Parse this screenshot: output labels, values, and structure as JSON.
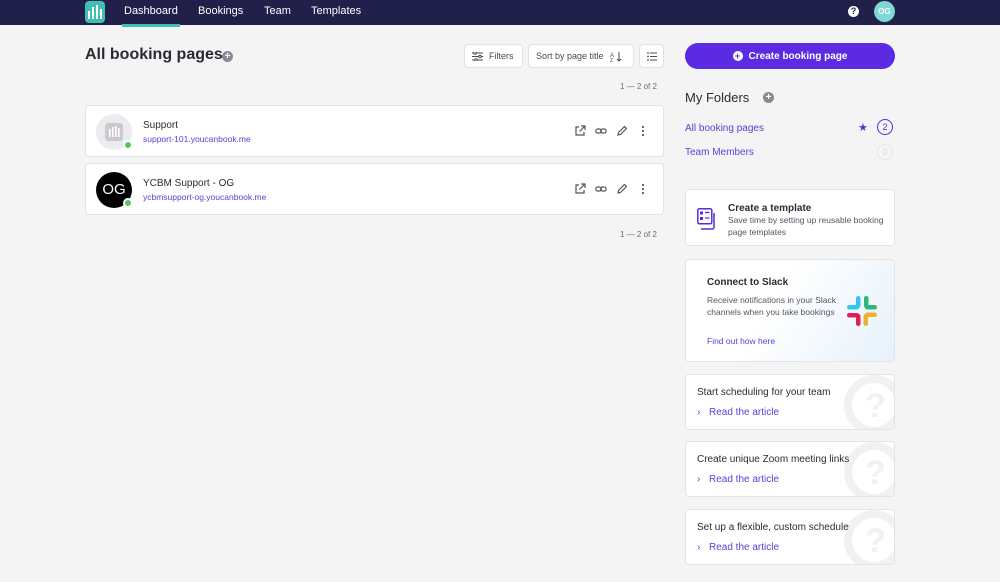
{
  "nav": {
    "items": [
      {
        "label": "Dashboard",
        "active": true
      },
      {
        "label": "Bookings",
        "active": false
      },
      {
        "label": "Team",
        "active": false
      },
      {
        "label": "Templates",
        "active": false
      }
    ],
    "help_icon": "?",
    "user_initials": "OG"
  },
  "main": {
    "title": "All booking pages",
    "filters_label": "Filters",
    "sort_label": "Sort by page title",
    "pagination_top": "1 — 2 of 2",
    "pagination_bottom": "1 — 2 of 2",
    "pages": [
      {
        "name": "Support",
        "url": "support-101.youcanbook.me",
        "avatar": "logo"
      },
      {
        "name": "YCBM Support - OG",
        "url": "ycbmsupport-og.youcanbook.me",
        "avatar_text": "OG"
      }
    ]
  },
  "sidebar": {
    "create_label": "Create booking page",
    "folders_title": "My Folders",
    "folders": [
      {
        "label": "All booking pages",
        "count": "2"
      },
      {
        "label": "Team Members",
        "count": "0"
      }
    ],
    "template_card": {
      "title": "Create a template",
      "description": "Save time by setting up reusable booking page templates"
    },
    "slack_card": {
      "title": "Connect to Slack",
      "description": "Receive notifications in your Slack channels when you take bookings",
      "link": "Find out how here"
    },
    "articles": [
      {
        "title": "Start scheduling for your team",
        "link": "Read the article"
      },
      {
        "title": "Create unique Zoom meeting links",
        "link": "Read the article"
      },
      {
        "title": "Set up a flexible, custom schedule",
        "link": "Read the article"
      }
    ]
  },
  "colors": {
    "nav_bg": "#20204a",
    "accent": "#5a2be0",
    "brand_teal": "#3fc0b3",
    "status_online": "#4cc95e"
  }
}
